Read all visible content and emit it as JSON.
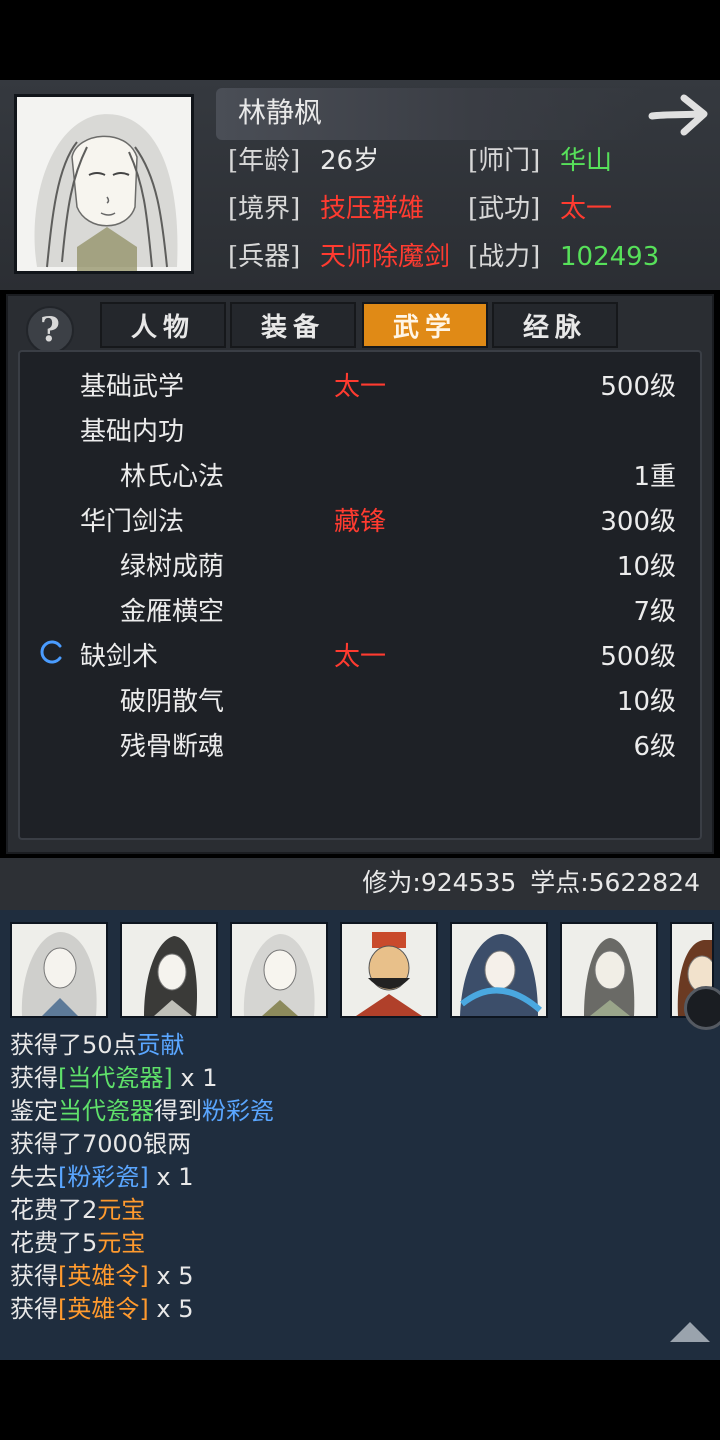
{
  "character": {
    "name": "林静枫",
    "fields": {
      "age_label": "[年龄]",
      "age": "26岁",
      "sect_label": "[师门]",
      "sect": "华山",
      "realm_label": "[境界]",
      "realm": "技压群雄",
      "martial_label": "[武功]",
      "martial": "太一",
      "weapon_label": "[兵器]",
      "weapon": "天师除魔剑",
      "power_label": "[战力]",
      "power": "102493"
    }
  },
  "help": "?",
  "tabs": [
    {
      "label": "人物",
      "active": false
    },
    {
      "label": "装备",
      "active": false
    },
    {
      "label": "武学",
      "active": true
    },
    {
      "label": "经脉",
      "active": false
    }
  ],
  "skills": [
    {
      "name": "基础武学",
      "style": "太一",
      "level": "500级"
    },
    {
      "name": "基础内功",
      "style": "",
      "level": ""
    },
    {
      "name": "林氏心法",
      "style": "",
      "level": "1重"
    },
    {
      "name": "华门剑法",
      "style": "藏锋",
      "level": "300级"
    },
    {
      "name": "绿树成荫",
      "style": "",
      "level": "10级"
    },
    {
      "name": "金雁横空",
      "style": "",
      "level": "7级"
    },
    {
      "name": "缺剑术",
      "style": "太一",
      "level": "500级"
    },
    {
      "name": "破阴散气",
      "style": "",
      "level": "10级"
    },
    {
      "name": "残骨断魂",
      "style": "",
      "level": "6级"
    }
  ],
  "stats": {
    "cultivation_label": "修为:",
    "cultivation": "924535",
    "points_label": "学点:",
    "points": "5622824"
  },
  "log": [
    {
      "parts": [
        {
          "t": "获得了50点",
          "c": "white"
        },
        {
          "t": "贡献",
          "c": "blue"
        }
      ]
    },
    {
      "parts": [
        {
          "t": "获得",
          "c": "white"
        },
        {
          "t": "[当代瓷器]",
          "c": "green"
        },
        {
          "t": " x 1",
          "c": "white"
        }
      ]
    },
    {
      "parts": [
        {
          "t": "鉴定",
          "c": "white"
        },
        {
          "t": "当代瓷器",
          "c": "green"
        },
        {
          "t": "得到",
          "c": "white"
        },
        {
          "t": "粉彩瓷",
          "c": "blue"
        }
      ]
    },
    {
      "parts": [
        {
          "t": "获得了7000银两",
          "c": "white"
        }
      ]
    },
    {
      "parts": [
        {
          "t": "失去",
          "c": "white"
        },
        {
          "t": "[粉彩瓷]",
          "c": "blue"
        },
        {
          "t": " x 1",
          "c": "white"
        }
      ]
    },
    {
      "parts": [
        {
          "t": "花费了2",
          "c": "white"
        },
        {
          "t": "元宝",
          "c": "orange"
        }
      ]
    },
    {
      "parts": [
        {
          "t": "花费了5",
          "c": "white"
        },
        {
          "t": "元宝",
          "c": "orange"
        }
      ]
    },
    {
      "parts": [
        {
          "t": "获得",
          "c": "white"
        },
        {
          "t": "[英雄令]",
          "c": "orange"
        },
        {
          "t": " x 5",
          "c": "white"
        }
      ]
    },
    {
      "parts": [
        {
          "t": "获得",
          "c": "white"
        },
        {
          "t": "[英雄令]",
          "c": "orange"
        },
        {
          "t": " x 5",
          "c": "white"
        }
      ]
    }
  ]
}
